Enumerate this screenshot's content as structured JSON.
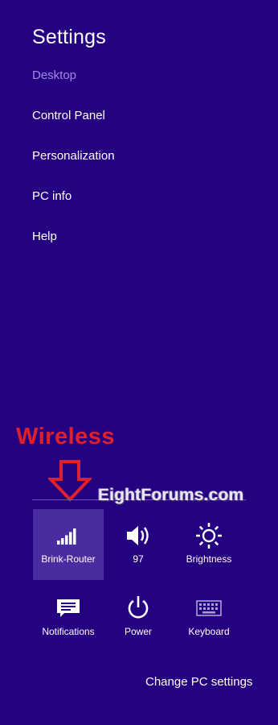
{
  "panel": {
    "title": "Settings",
    "subtitle": "Desktop",
    "menu": [
      {
        "label": "Control Panel"
      },
      {
        "label": "Personalization"
      },
      {
        "label": "PC info"
      },
      {
        "label": "Help"
      }
    ]
  },
  "annotation": {
    "text": "Wireless",
    "color": "#e0202a"
  },
  "watermark": {
    "text": "EightForums.com"
  },
  "quick_settings": {
    "tiles": [
      {
        "label": "Brink-Router",
        "icon": "wifi-signal-icon",
        "selected": true
      },
      {
        "label": "97",
        "icon": "volume-icon"
      },
      {
        "label": "Brightness",
        "icon": "brightness-icon"
      },
      {
        "label": "Notifications",
        "icon": "notifications-icon"
      },
      {
        "label": "Power",
        "icon": "power-icon"
      },
      {
        "label": "Keyboard",
        "icon": "keyboard-icon"
      }
    ],
    "change_pc_settings": "Change PC settings"
  },
  "colors": {
    "background": "#250081",
    "selected_tile": "#4a2ca1",
    "subtitle": "#a08ce6"
  }
}
